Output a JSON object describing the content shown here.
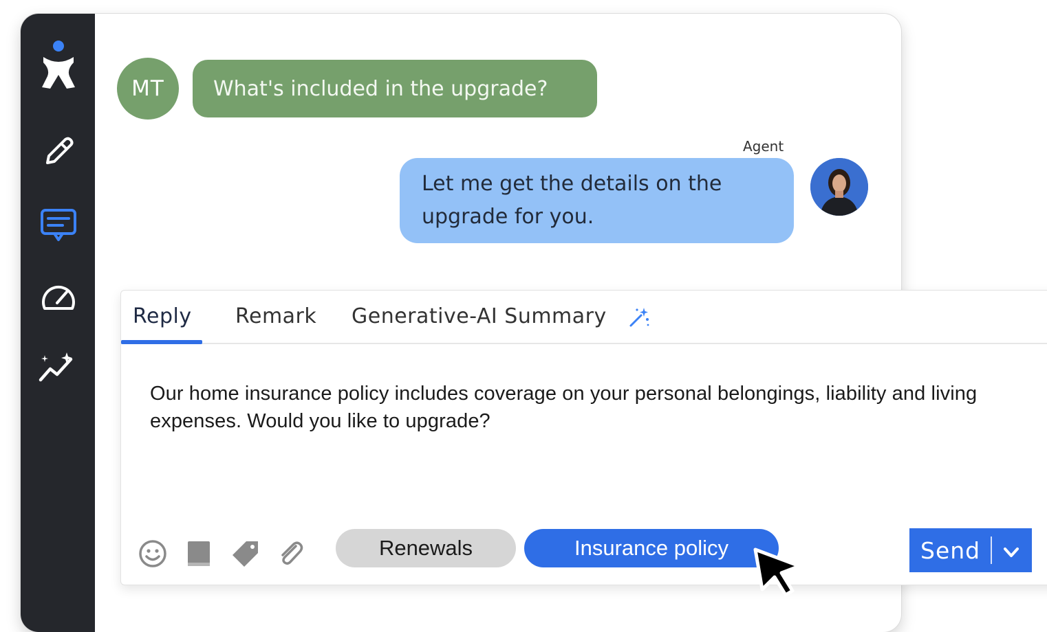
{
  "sidebar": {
    "items": [
      {
        "icon": "brand-logo-icon"
      },
      {
        "icon": "pencil-icon"
      },
      {
        "icon": "chat-icon",
        "active": true
      },
      {
        "icon": "speedometer-icon"
      },
      {
        "icon": "sparkle-trend-icon"
      }
    ],
    "active_color": "#3b82f6"
  },
  "conversation": {
    "customer_initials": "MT",
    "customer_message": "What's included in the upgrade?",
    "agent_label": "Agent",
    "agent_message": "Let me get the details on the upgrade for you."
  },
  "composer": {
    "tabs": [
      {
        "label": "Reply",
        "active": true
      },
      {
        "label": "Remark"
      },
      {
        "label": "Generative-AI Summary",
        "icon": "magic-wand-icon"
      }
    ],
    "message": "Our home insurance policy includes coverage on your personal belongings, liability and living expenses. Would you like to upgrade?",
    "tools": [
      "emoji-icon",
      "book-icon",
      "tag-icon",
      "paperclip-icon"
    ],
    "chips": [
      {
        "label": "Renewals"
      },
      {
        "label": "Insurance policy",
        "selected": true
      }
    ],
    "send_label": "Send"
  },
  "colors": {
    "sidebar_bg": "#25272c",
    "customer_bubble": "#76a06c",
    "agent_bubble": "#93c1f7",
    "accent": "#2f6ee6"
  }
}
